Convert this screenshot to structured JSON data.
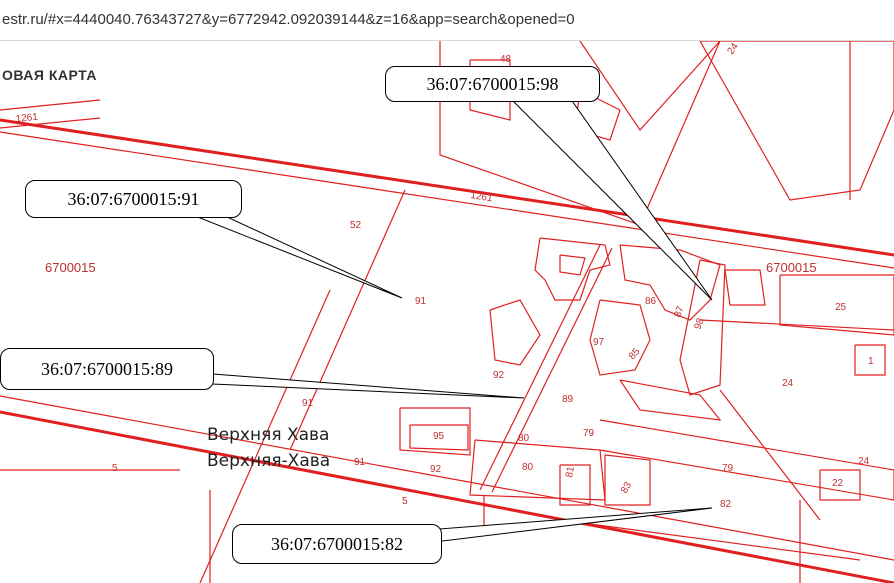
{
  "browser": {
    "url": "estr.ru/#x=4440040.76343727&y=6772942.092039144&z=16&app=search&opened=0"
  },
  "map": {
    "title": "ОВАЯ КАРТА",
    "places": [
      "Верхняя Хава",
      "Верхняя-Хава"
    ],
    "quarter_labels": [
      "6700015",
      "6700015"
    ],
    "road_labels": [
      "1261",
      "1261"
    ],
    "parcel_labels": [
      "48",
      "24",
      "52",
      "91",
      "86",
      "87",
      "98",
      "25",
      "97",
      "85",
      "92",
      "1",
      "24",
      "89",
      "91",
      "95",
      "80",
      "79",
      "91",
      "92",
      "80",
      "81",
      "79",
      "24",
      "5",
      "83",
      "22",
      "5",
      "82"
    ],
    "callouts": [
      "36:07:6700015:98",
      "36:07:6700015:91",
      "36:07:6700015:89",
      "36:07:6700015:82"
    ]
  },
  "colors": {
    "boundary": "#e02020",
    "label": "#c03030",
    "callout_border": "#000000"
  }
}
